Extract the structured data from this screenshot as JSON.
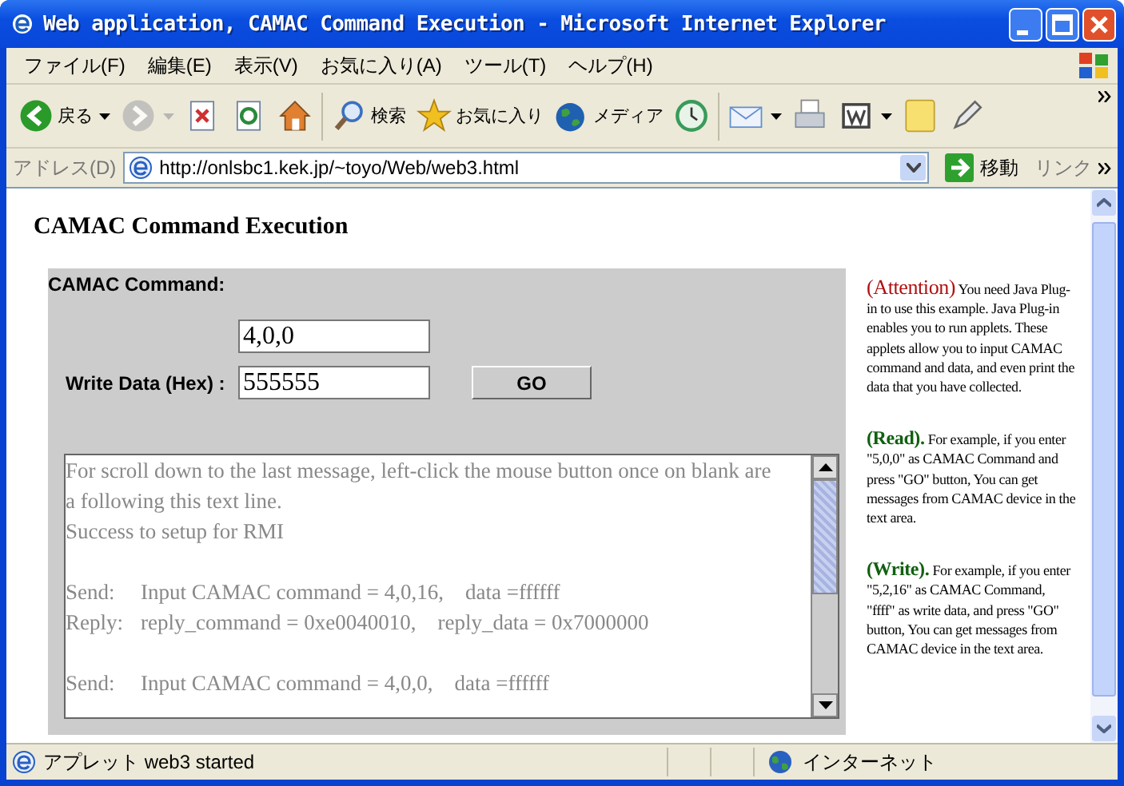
{
  "window": {
    "title": "Web application, CAMAC Command Execution - Microsoft Internet Explorer"
  },
  "menu": [
    {
      "label": "ファイル(F)"
    },
    {
      "label": "編集(E)"
    },
    {
      "label": "表示(V)"
    },
    {
      "label": "お気に入り(A)"
    },
    {
      "label": "ツール(T)"
    },
    {
      "label": "ヘルプ(H)"
    }
  ],
  "toolbar": [
    {
      "kind": "back",
      "label": "戻る",
      "dropdown": true,
      "disabled": false
    },
    {
      "kind": "forward",
      "dropdown": true,
      "disabled": true
    },
    {
      "kind": "stop",
      "dropdown": false,
      "disabled": false
    },
    {
      "kind": "refresh",
      "dropdown": false,
      "disabled": false
    },
    {
      "kind": "home",
      "dropdown": false,
      "disabled": false
    },
    {
      "kind": "separator"
    },
    {
      "kind": "search",
      "label": "検索",
      "dropdown": false,
      "disabled": false
    },
    {
      "kind": "favorites",
      "label": "お気に入り",
      "dropdown": false,
      "disabled": false
    },
    {
      "kind": "media",
      "label": "メディア",
      "dropdown": false,
      "disabled": false
    },
    {
      "kind": "history",
      "dropdown": false,
      "disabled": false
    },
    {
      "kind": "separator"
    },
    {
      "kind": "mail",
      "dropdown": true,
      "disabled": false
    },
    {
      "kind": "print",
      "dropdown": false,
      "disabled": false
    },
    {
      "kind": "edit",
      "dropdown": true,
      "disabled": false
    },
    {
      "kind": "note",
      "dropdown": false,
      "disabled": false
    },
    {
      "kind": "tool",
      "dropdown": false,
      "disabled": false
    }
  ],
  "address_bar": {
    "label": "アドレス(D)",
    "url": "http://onlsbc1.kek.jp/~toyo/Web/web3.html",
    "go": "移動",
    "links": "リンク"
  },
  "page": {
    "heading": "CAMAC Command Execution",
    "applet": {
      "command_label": "CAMAC Command:",
      "command_value": "4,0,0",
      "write_label": "Write Data (Hex) :",
      "write_value": "555555",
      "go_button": "GO",
      "log_groups": [
        [
          {
            "text": "For scroll down to the last message, left-click the mouse button once on blank are"
          },
          {
            "text": "a following this text line."
          },
          {
            "text": "Success to setup for RMI"
          }
        ],
        [
          {
            "label": "Send:",
            "text": "Input CAMAC command = 4,0,16,    data =ffffff"
          },
          {
            "label": "Reply:",
            "text": "reply_command = 0xe0040010,    reply_data = 0x7000000"
          }
        ],
        [
          {
            "label": "Send:",
            "text": "Input CAMAC command = 4,0,0,    data =ffffff"
          }
        ]
      ]
    },
    "notes": [
      {
        "kind": "attention",
        "heading": "(Attention)",
        "color": "#b01010",
        "text": "You need Java Plug-in to use this example. Java Plug-in enables you to run applets. These applets allow you to input CAMAC command and data, and even print the data that you have collected."
      },
      {
        "kind": "example",
        "heading": "(Read).",
        "color": "#106010",
        "text": "For example, if you enter \"5,0,0\" as CAMAC Command and press \"GO\" button, You can get messages from CAMAC device in the text area."
      },
      {
        "kind": "example",
        "heading": "(Write).",
        "color": "#106010",
        "text": "For example, if you enter \"5,2,16\" as CAMAC Command, \"ffff\" as write data, and press \"GO\" button, You can get messages from CAMAC device in the text area."
      }
    ]
  },
  "status_bar": {
    "text": "アプレット web3 started",
    "zone": "インターネット"
  }
}
